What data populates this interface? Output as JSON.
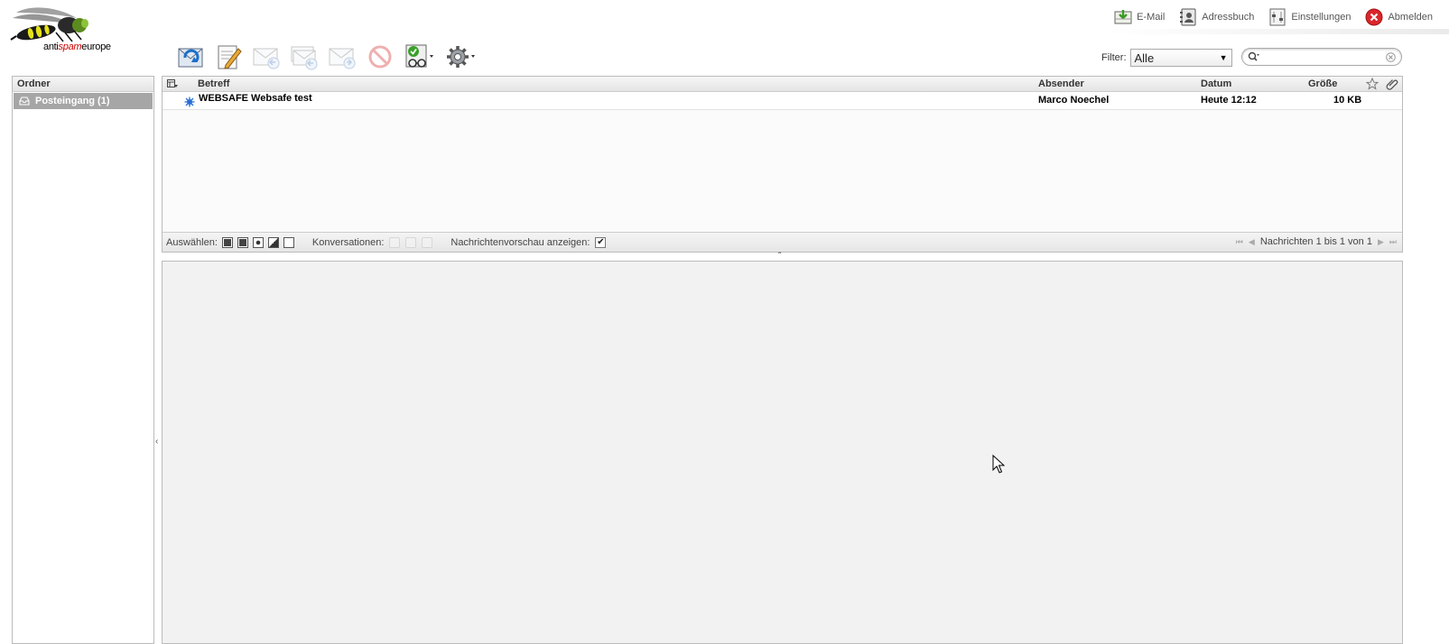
{
  "logo": {
    "text_anti": "anti",
    "text_spam": "spam",
    "text_europe": "europe"
  },
  "topnav": {
    "items": [
      {
        "label": "E-Mail",
        "icon": "email-icon"
      },
      {
        "label": "Adressbuch",
        "icon": "addressbook-icon"
      },
      {
        "label": "Einstellungen",
        "icon": "settings-icon"
      },
      {
        "label": "Abmelden",
        "icon": "logout-icon"
      }
    ]
  },
  "toolbar": {
    "buttons": [
      {
        "name": "check-mail-button",
        "icon": "refresh-mail-icon",
        "enabled": true
      },
      {
        "name": "compose-button",
        "icon": "compose-icon",
        "enabled": true
      },
      {
        "name": "reply-button",
        "icon": "reply-icon",
        "enabled": false
      },
      {
        "name": "reply-all-button",
        "icon": "reply-all-icon",
        "enabled": false
      },
      {
        "name": "forward-button",
        "icon": "forward-icon",
        "enabled": false
      },
      {
        "name": "delete-button",
        "icon": "delete-icon",
        "enabled": false
      },
      {
        "name": "mark-button",
        "icon": "mark-icon",
        "enabled": true
      },
      {
        "name": "more-actions-button",
        "icon": "gear-icon",
        "enabled": true
      }
    ]
  },
  "filter": {
    "label": "Filter:",
    "selected": "Alle"
  },
  "search": {
    "placeholder": ""
  },
  "folders": {
    "header": "Ordner",
    "items": [
      {
        "label": "Posteingang (1)",
        "selected": true
      }
    ]
  },
  "message_list": {
    "columns": {
      "subject": "Betreff",
      "sender": "Absender",
      "date": "Datum",
      "size": "Größe"
    },
    "rows": [
      {
        "subject": "WEBSAFE Websafe test",
        "sender": "Marco Noechel",
        "date": "Heute 12:12",
        "size": "10 KB",
        "unread": true
      }
    ],
    "footer": {
      "select_label": "Auswählen:",
      "threads_label": "Konversationen:",
      "preview_label": "Nachrichtenvorschau anzeigen:",
      "preview_checked": true,
      "count_text": "Nachrichten 1 bis 1 von 1"
    }
  },
  "colors": {
    "selected_folder_bg": "#a6a6a6",
    "unread_star": "#2a6fd6",
    "logout_red": "#d9262b"
  }
}
